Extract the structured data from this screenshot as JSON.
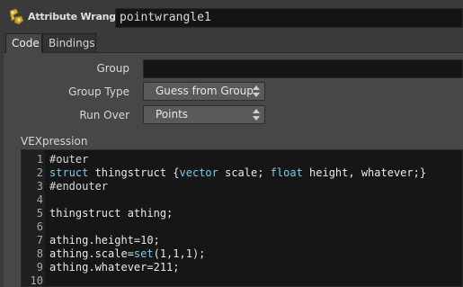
{
  "header": {
    "node_type": "Attribute Wrangle",
    "node_name": "pointwrangle1",
    "icon": "wrangle-node-icon"
  },
  "tabs": [
    {
      "label": "Code",
      "active": true
    },
    {
      "label": "Bindings",
      "active": false
    }
  ],
  "params": {
    "group": {
      "label": "Group",
      "value": ""
    },
    "group_type": {
      "label": "Group Type",
      "value": "Guess from Group"
    },
    "run_over": {
      "label": "Run Over",
      "value": "Points"
    }
  },
  "vex": {
    "label": "VEXpression",
    "lines": [
      {
        "n": "1",
        "tokens": [
          {
            "t": "#outer",
            "c": "t-directive"
          }
        ]
      },
      {
        "n": "2",
        "tokens": [
          {
            "t": "struct",
            "c": "t-kw"
          },
          {
            "t": " thingstruct {",
            "c": "t-plain"
          },
          {
            "t": "vector",
            "c": "t-kw"
          },
          {
            "t": " scale; ",
            "c": "t-plain"
          },
          {
            "t": "float",
            "c": "t-kw"
          },
          {
            "t": " height, whatever;}",
            "c": "t-plain"
          }
        ]
      },
      {
        "n": "3",
        "tokens": [
          {
            "t": "#endouter",
            "c": "t-directive"
          }
        ]
      },
      {
        "n": "4",
        "tokens": []
      },
      {
        "n": "5",
        "tokens": [
          {
            "t": "thingstruct athing;",
            "c": "t-plain"
          }
        ]
      },
      {
        "n": "6",
        "tokens": []
      },
      {
        "n": "7",
        "tokens": [
          {
            "t": "athing.height=10;",
            "c": "t-plain"
          }
        ]
      },
      {
        "n": "8",
        "tokens": [
          {
            "t": "athing.scale=",
            "c": "t-plain"
          },
          {
            "t": "set",
            "c": "t-kw"
          },
          {
            "t": "(1,1,1);",
            "c": "t-plain"
          }
        ]
      },
      {
        "n": "9",
        "tokens": [
          {
            "t": "athing.whatever=211;",
            "c": "t-plain"
          }
        ]
      },
      {
        "n": "10",
        "tokens": []
      }
    ]
  },
  "colors": {
    "background": "#3a3a3a",
    "panel": "#474747",
    "field": "#151515",
    "editor": "#161616",
    "keyword": "#7ec8e8"
  }
}
